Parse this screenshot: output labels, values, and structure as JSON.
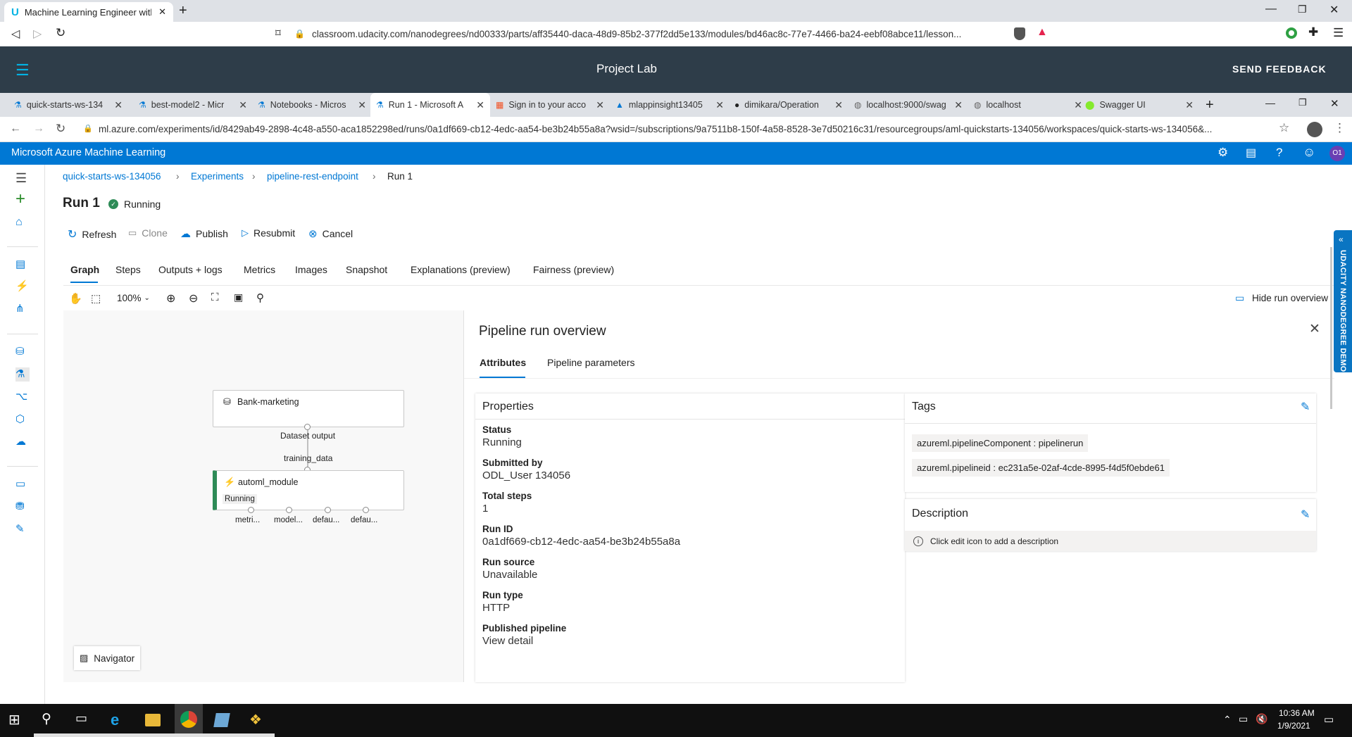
{
  "outer_browser": {
    "tab_title": "Machine Learning Engineer with M",
    "url": "classroom.udacity.com/nanodegrees/nd00333/parts/aff35440-daca-48d9-85b2-377f2dd5e133/modules/bd46ac8c-77e7-4466-ba24-eebf08abce11/lesson..."
  },
  "udacity": {
    "title": "Project Lab",
    "feedback": "SEND FEEDBACK",
    "side_tab": "UDACITY NANODEGREE DEMO"
  },
  "inner_browser": {
    "tabs": [
      {
        "label": "quick-starts-ws-134",
        "icon": "azure-ml-icon"
      },
      {
        "label": "best-model2 - Micr",
        "icon": "azure-ml-icon"
      },
      {
        "label": "Notebooks - Micros",
        "icon": "azure-ml-icon"
      },
      {
        "label": "Run 1 - Microsoft A",
        "icon": "azure-ml-icon"
      },
      {
        "label": "Sign in to your acco",
        "icon": "microsoft-icon"
      },
      {
        "label": "mlappinsight13405",
        "icon": "azure-icon"
      },
      {
        "label": "dimikara/Operation",
        "icon": "github-icon"
      },
      {
        "label": "localhost:9000/swag",
        "icon": "globe-icon"
      },
      {
        "label": "localhost",
        "icon": "globe-icon"
      },
      {
        "label": "Swagger UI",
        "icon": "swagger-icon"
      }
    ],
    "url": "ml.azure.com/experiments/id/8429ab49-2898-4c48-a550-aca1852298ed/runs/0a1df669-cb12-4edc-aa54-be3b24b55a8a?wsid=/subscriptions/9a7511b8-150f-4a58-8528-3e7d50216c31/resourcegroups/aml-quickstarts-134056/workspaces/quick-starts-ws-134056&..."
  },
  "azure": {
    "app_title": "Microsoft Azure Machine Learning",
    "avatar": "O1",
    "breadcrumb": [
      "quick-starts-ws-134056",
      "Experiments",
      "pipeline-rest-endpoint",
      "Run 1"
    ],
    "run_title": "Run 1",
    "run_status": "Running",
    "commands": [
      "Refresh",
      "Clone",
      "Publish",
      "Resubmit",
      "Cancel"
    ],
    "tabs": [
      "Graph",
      "Steps",
      "Outputs + logs",
      "Metrics",
      "Images",
      "Snapshot",
      "Explanations (preview)",
      "Fairness (preview)"
    ],
    "zoom": "100%",
    "hide_overview": "Hide run overview",
    "navigator": "Navigator",
    "graph": {
      "dataset_node": "Bank-marketing",
      "dataset_output": "Dataset output",
      "edge_label": "training_data",
      "module_node": "automl_module",
      "module_status": "Running",
      "outputs": [
        "metri...",
        "model...",
        "defau...",
        "defau..."
      ]
    },
    "overview": {
      "title": "Pipeline run overview",
      "tabs": [
        "Attributes",
        "Pipeline parameters"
      ],
      "properties_title": "Properties",
      "properties": [
        {
          "label": "Status",
          "value": "Running"
        },
        {
          "label": "Submitted by",
          "value": "ODL_User 134056"
        },
        {
          "label": "Total steps",
          "value": "1"
        },
        {
          "label": "Run ID",
          "value": "0a1df669-cb12-4edc-aa54-be3b24b55a8a"
        },
        {
          "label": "Run source",
          "value": "Unavailable"
        },
        {
          "label": "Run type",
          "value": "HTTP"
        },
        {
          "label": "Published pipeline",
          "value": "View detail"
        }
      ],
      "tags_title": "Tags",
      "tags": [
        "azureml.pipelineComponent : pipelinerun",
        "azureml.pipelineid : ec231a5e-02af-4cde-8995-f4d5f0ebde61"
      ],
      "description_title": "Description",
      "description_hint": "Click edit icon to add a description"
    }
  },
  "taskbar": {
    "time": "10:36 AM",
    "date": "1/9/2021"
  },
  "colors": {
    "azure_blue": "#0078d4",
    "udacity_header": "#2e3d49",
    "running_green": "#2e8b57"
  }
}
